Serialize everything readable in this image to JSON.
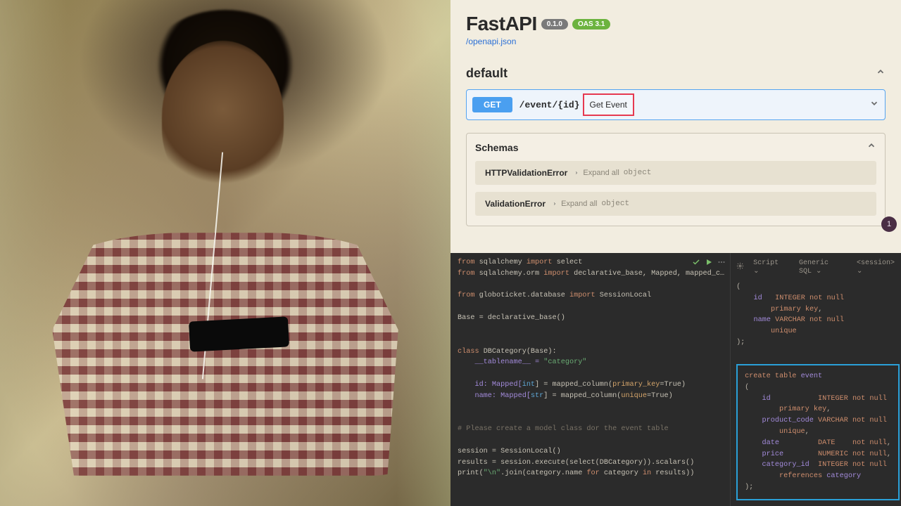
{
  "swagger": {
    "title": "FastAPI",
    "version_badge": "0.1.0",
    "oas_badge": "OAS 3.1",
    "openapi_link": "/openapi.json",
    "section_default": "default",
    "endpoint": {
      "method": "GET",
      "path": "/event/{id}",
      "summary": "Get Event"
    },
    "schemas_title": "Schemas",
    "schemas": [
      {
        "name": "HTTPValidationError",
        "expand": "Expand all",
        "type": "object"
      },
      {
        "name": "ValidationError",
        "expand": "Expand all",
        "type": "object"
      }
    ],
    "corner_badge": "1"
  },
  "code": {
    "line1_from": "from ",
    "line1_mod": "sqlalchemy ",
    "line1_import": "import ",
    "line1_items": "select",
    "line2_from": "from ",
    "line2_mod": "sqlalchemy.orm ",
    "line2_import": "import ",
    "line2_items": "declarative_base, Mapped, mapped_c…",
    "line3_from": "from ",
    "line3_mod": "globoticket.database ",
    "line3_import": "import ",
    "line3_items": "SessionLocal",
    "line4": "Base = declarative_base()",
    "cls_kw": "class ",
    "cls_name": "DBCategory(Base):",
    "tab_name_lhs": "    __tablename__ = ",
    "tab_name_str": "\"category\"",
    "id_lhs": "    id: Mapped[",
    "id_type": "int",
    "id_mid": "] = mapped_column(",
    "id_param": "primary_key",
    "id_rhs": "=True)",
    "name_lhs": "    name: Mapped[",
    "name_type": "str",
    "name_mid": "] = mapped_column(",
    "name_param": "unique",
    "name_rhs": "=True)",
    "comment": "# Please create a model class dor the event table",
    "sess": "session = SessionLocal()",
    "results": "results = session.execute(select(DBCategory)).scalars()",
    "print_a": "print(",
    "print_str": "\"\\n\"",
    "print_b": ".join(category.name ",
    "print_for": "for ",
    "print_c": "category ",
    "print_in": "in ",
    "print_d": "results))"
  },
  "ide_right": {
    "script_label": "Script",
    "dialect": "Generic SQL",
    "session": "<session>",
    "sql_top_lines": [
      "(",
      "    id   INTEGER not null",
      "        primary key,",
      "    name VARCHAR not null",
      "        unique",
      ");"
    ],
    "sql_event": [
      "create table event",
      "(",
      "    id           INTEGER not null",
      "        primary key,",
      "    product_code VARCHAR not null",
      "        unique,",
      "    date         DATE    not null,",
      "    price        NUMERIC not null,",
      "    category_id  INTEGER not null",
      "        references category",
      ");"
    ]
  }
}
